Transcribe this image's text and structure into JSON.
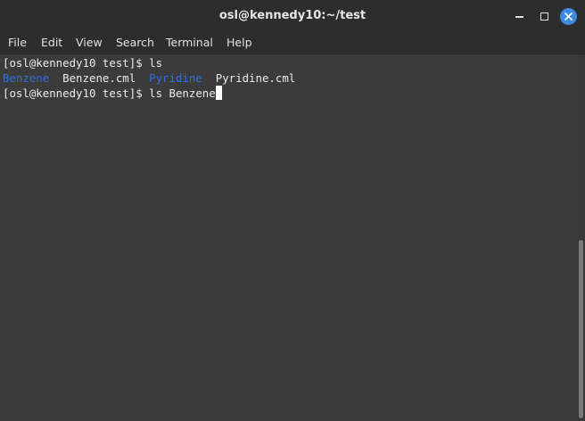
{
  "window": {
    "title": "osl@kennedy10:~/test"
  },
  "menubar": {
    "items": [
      "File",
      "Edit",
      "View",
      "Search",
      "Terminal",
      "Help"
    ]
  },
  "terminal": {
    "line1": {
      "prompt": "[osl@kennedy10 test]$ ",
      "command": "ls"
    },
    "line2": {
      "dir1": "Benzene",
      "file1": "Benzene.cml",
      "dir2": "Pyridine",
      "file2": "Pyridine.cml"
    },
    "line3": {
      "prompt": "[osl@kennedy10 test]$ ",
      "command": "ls Benzene"
    }
  },
  "colors": {
    "directory": "#2f6fe0",
    "close_button": "#3f8ae0",
    "background": "#3b3b3b"
  },
  "icons": [
    "minimize-icon",
    "maximize-icon",
    "close-icon"
  ]
}
